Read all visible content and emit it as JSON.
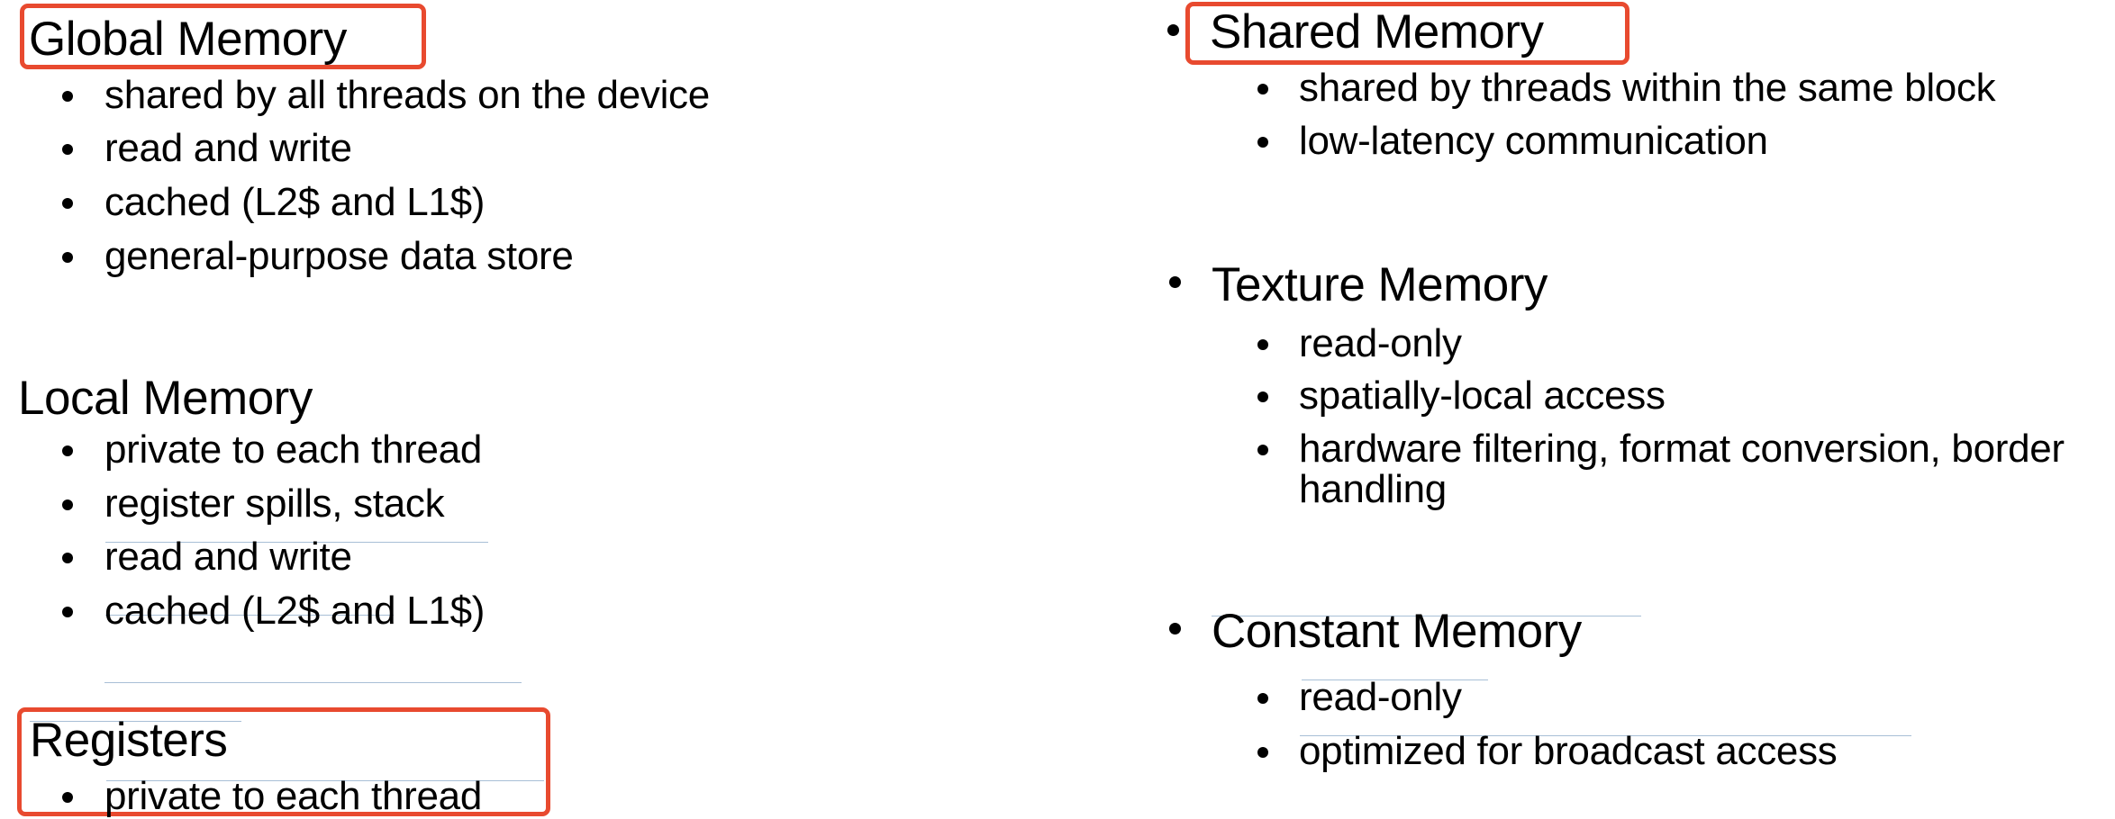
{
  "left_column": {
    "sections": [
      {
        "title": "Global Memory",
        "highlighted": true,
        "items": [
          "shared by all threads on the device",
          "read and write",
          "cached (L2$ and L1$)",
          "general-purpose data store"
        ]
      },
      {
        "title": "Local Memory",
        "highlighted": false,
        "items": [
          "private to each thread",
          "register spills, stack",
          "read and write",
          "cached (L2$ and L1$)"
        ]
      },
      {
        "title": "Registers",
        "highlighted": true,
        "items": [
          "private to each thread"
        ]
      }
    ]
  },
  "right_column": {
    "sections": [
      {
        "title": "Shared Memory",
        "highlighted": true,
        "items": [
          "shared by threads within the same block",
          "low-latency communication"
        ]
      },
      {
        "title": "Texture Memory",
        "highlighted": false,
        "items": [
          "read-only",
          "spatially-local access",
          "hardware filtering, format conversion, border handling"
        ]
      },
      {
        "title": "Constant Memory",
        "highlighted": false,
        "items": [
          "read-only",
          "optimized for broadcast access"
        ]
      }
    ]
  },
  "colors": {
    "highlight_box": "#E84A2F",
    "text": "#000000",
    "guide_line": "#A8BFD6",
    "background": "#FFFFFF"
  }
}
